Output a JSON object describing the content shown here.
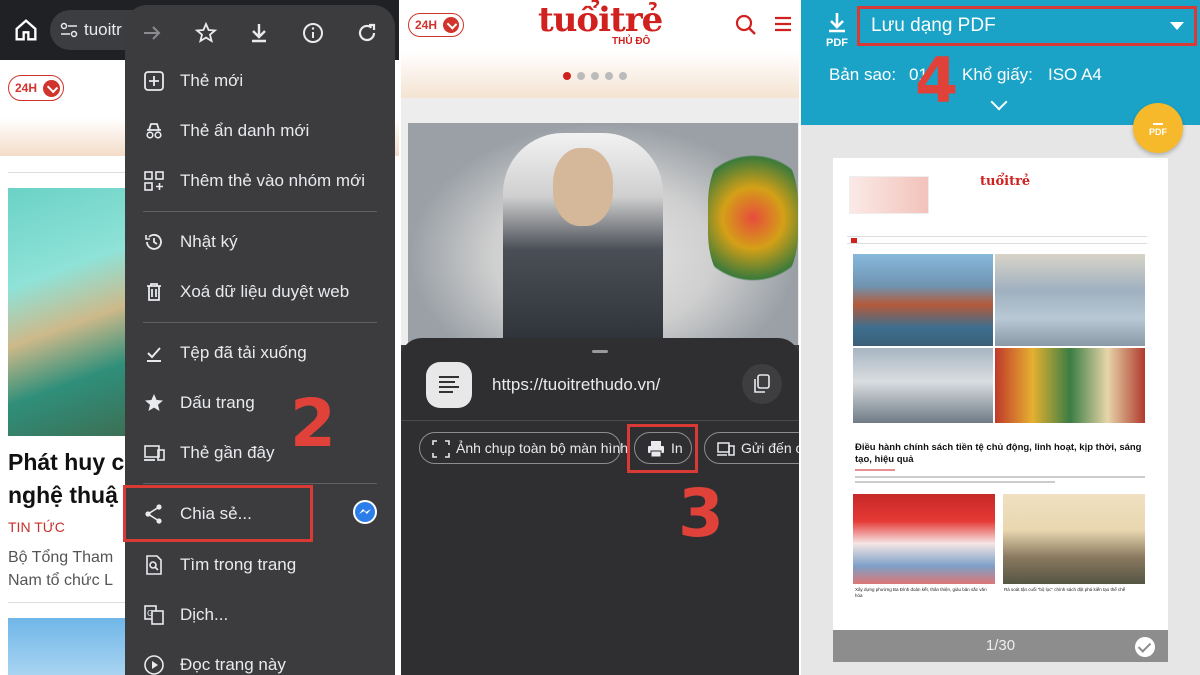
{
  "panel1": {
    "url_text": "tuoitr",
    "badge": "24H",
    "headline": "Phát huy c\nnghệ thuậ",
    "category": "TIN TỨC",
    "description": "Bộ Tổng Tham\nNam tổ chức L",
    "menu": {
      "toolbar_icons": [
        "forward-arrow-icon",
        "star-icon",
        "download-icon",
        "info-icon",
        "refresh-icon"
      ],
      "items": [
        {
          "label": "Thẻ mới",
          "icon": "new-tab-icon"
        },
        {
          "label": "Thẻ ẩn danh mới",
          "icon": "incognito-icon"
        },
        {
          "label": "Thêm thẻ vào nhóm mới",
          "icon": "tab-group-icon"
        },
        {
          "label": "Nhật ký",
          "icon": "history-icon"
        },
        {
          "label": "Xoá dữ liệu duyệt web",
          "icon": "trash-icon"
        },
        {
          "label": "Tệp đã tải xuống",
          "icon": "downloads-icon"
        },
        {
          "label": "Dấu trang",
          "icon": "bookmark-star-icon"
        },
        {
          "label": "Thẻ gần đây",
          "icon": "devices-icon"
        },
        {
          "label": "Chia sẻ...",
          "icon": "share-icon"
        },
        {
          "label": "Tìm trong trang",
          "icon": "find-in-page-icon"
        },
        {
          "label": "Dịch...",
          "icon": "translate-icon"
        },
        {
          "label": "Đọc trang này",
          "icon": "play-icon"
        }
      ]
    },
    "step": "2"
  },
  "panel2": {
    "badge": "24H",
    "logo": "tuổitrẻ",
    "logo_sub": "THỦ ĐÔ",
    "share_url": "https://tuoitrethudo.vn/",
    "chips": [
      "Ảnh chụp toàn bộ màn hình",
      "In",
      "Gửi đến cá"
    ],
    "step": "3"
  },
  "panel3": {
    "pdf_icon_label": "PDF",
    "printer_select": "Lưu dạng PDF",
    "copies_label": "Bản sao:",
    "copies_value": "01",
    "paper_label": "Khổ giấy:",
    "paper_value": "ISO A4",
    "fab_label": "PDF",
    "step": "4",
    "preview": {
      "logo": "tuổitrẻ",
      "headline": "Điều hành chính sách tiền tệ chủ động, linh hoạt, kịp thời, sáng tạo, hiệu quả",
      "caption1": "Xây dựng phường Ba Đình đoàn kết, thân thiện, giàu bản sắc văn hóa",
      "caption2": "Rà soát tận cuối \"bộ lọc\" chính sách đột phá kiến tạo thể chế",
      "page_indicator": "1/30"
    }
  },
  "colors": {
    "accent_red": "#d93a36",
    "pdf_blue": "#1aa3c7",
    "brand_red": "#d1211f"
  }
}
